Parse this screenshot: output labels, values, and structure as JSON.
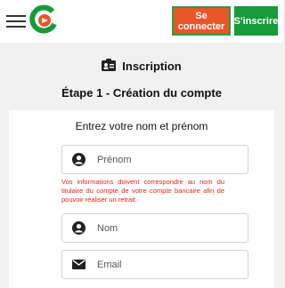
{
  "header": {
    "menu_icon": "hamburger-menu-icon",
    "logo_icon": "brand-logo",
    "login_label": "Se connecter",
    "register_label": "S'inscrire",
    "colors": {
      "login_bg": "#e8562a",
      "register_bg": "#179b3a",
      "brand_green": "#179b3a",
      "brand_orange": "#e8562a"
    }
  },
  "page": {
    "section_icon": "id-card-icon",
    "section_title": "Inscription",
    "step_title": "Étape 1 - Création du compte"
  },
  "form": {
    "heading": "Entrez votre nom et prénom",
    "first_name": {
      "icon": "user-icon",
      "placeholder": "Prénom",
      "value": ""
    },
    "help_text": "Vos informations doivent correspondre au nom du titulaire du compte de votre compte bancaire afin de pouvoir réaliser un retrait.",
    "last_name": {
      "icon": "user-icon",
      "placeholder": "Nom",
      "value": ""
    },
    "email": {
      "icon": "envelope-icon",
      "placeholder": "Email",
      "value": ""
    },
    "error_color": "#e2231a"
  }
}
